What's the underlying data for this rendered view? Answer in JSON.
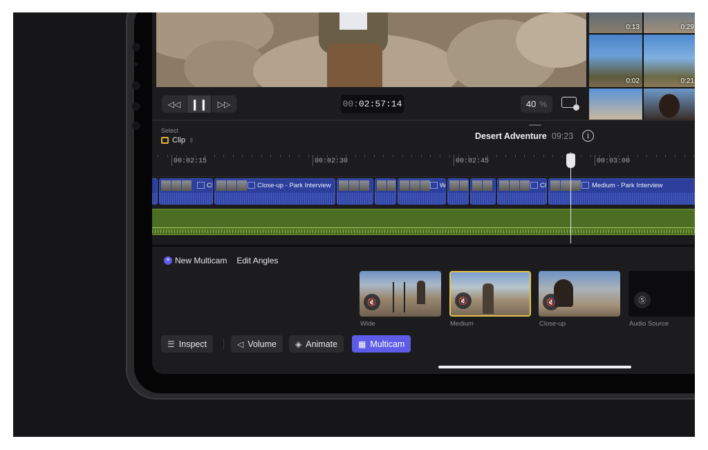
{
  "browser": {
    "thumbs": [
      {
        "duration": "0:13"
      },
      {
        "duration": "0:29"
      },
      {
        "duration": "0:02"
      },
      {
        "duration": "0:21"
      },
      {
        "duration": ""
      },
      {
        "duration": ""
      }
    ]
  },
  "transport": {
    "rewind_icon": "rewind-icon",
    "pause_icon": "pause-icon",
    "forward_icon": "fast-forward-icon",
    "timecode_dim": "00:",
    "timecode_main": "02:57:14",
    "zoom_value": "40",
    "zoom_unit": "%",
    "display_icon": "display-settings-icon"
  },
  "project": {
    "select_label": "Select",
    "select_mode": "Clip",
    "title": "Desert Adventure",
    "duration": "09:23"
  },
  "ruler": {
    "ticks": [
      "00:02:15",
      "00:02:30",
      "00:02:45",
      "00:03:00"
    ]
  },
  "clips": [
    {
      "name": ""
    },
    {
      "name": "Clo"
    },
    {
      "name": "Close-up - Park Interview"
    },
    {
      "name": ""
    },
    {
      "name": ""
    },
    {
      "name": "W"
    },
    {
      "name": ""
    },
    {
      "name": ""
    },
    {
      "name": "Cl"
    },
    {
      "name": "Medium - Park Interview"
    }
  ],
  "multicam": {
    "new_label": "New Multicam",
    "edit_label": "Edit Angles",
    "angles": [
      {
        "label": "Wide"
      },
      {
        "label": "Medium"
      },
      {
        "label": "Close-up"
      },
      {
        "label": "Audio Source"
      }
    ]
  },
  "toolbar": {
    "inspect": "Inspect",
    "volume": "Volume",
    "animate": "Animate",
    "multicam": "Multicam"
  },
  "colors": {
    "accent": "#5e5ce6",
    "clip_blue": "#2c3f9a",
    "audio_green": "#4d6d22",
    "selection_yellow": "#e6c24a"
  }
}
